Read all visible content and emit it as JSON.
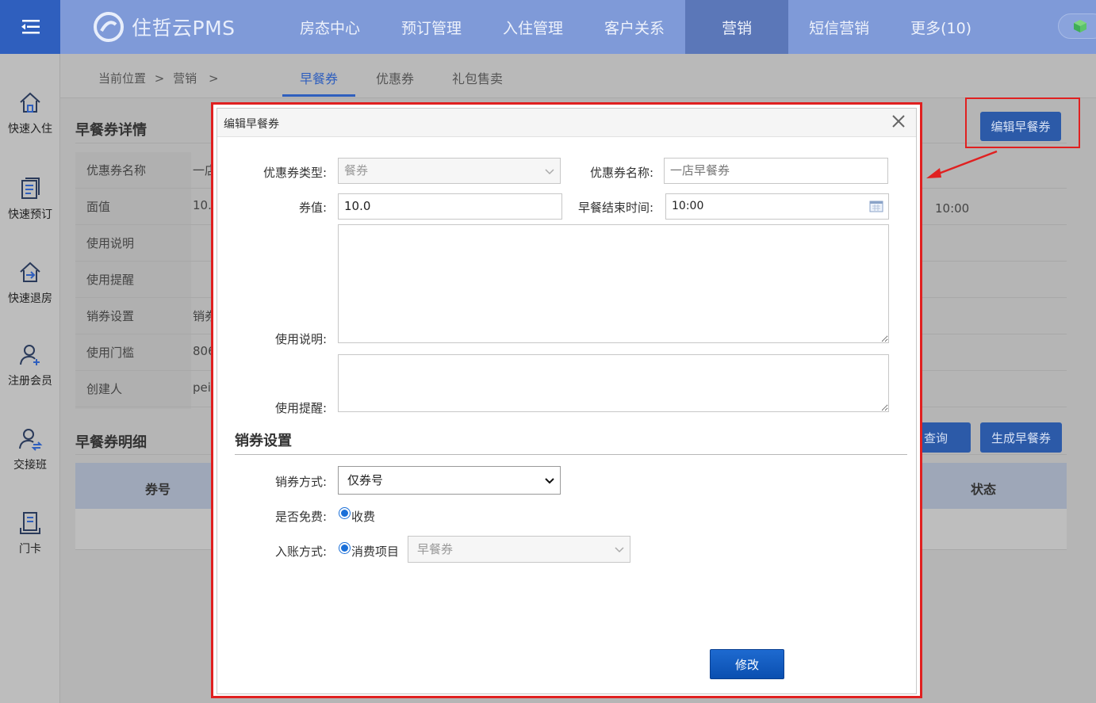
{
  "app": {
    "title": "住哲云PMS",
    "nav": [
      "房态中心",
      "预订管理",
      "入住管理",
      "客户关系",
      "营销",
      "短信营销",
      "更多(10)"
    ],
    "active_nav": "营销"
  },
  "sidebar": {
    "items": [
      {
        "label": "快速入住",
        "icon": "home-icon"
      },
      {
        "label": "快速预订",
        "icon": "list-icon"
      },
      {
        "label": "快速退房",
        "icon": "checkout-icon"
      },
      {
        "label": "注册会员",
        "icon": "add-user-icon"
      },
      {
        "label": "交接班",
        "icon": "shift-icon"
      },
      {
        "label": "门卡",
        "icon": "card-icon"
      }
    ]
  },
  "breadcrumb": {
    "position": "当前位置",
    "sep": ">",
    "section": "营销",
    "trail": ">"
  },
  "subtabs": [
    "早餐券",
    "优惠券",
    "礼包售卖"
  ],
  "detail": {
    "title": "早餐券详情",
    "edit_button": "编辑早餐券",
    "rows": [
      {
        "label": "优惠券名称",
        "value": "一店"
      },
      {
        "label": "面值",
        "value": "10."
      },
      {
        "label": "使用说明",
        "value": ""
      },
      {
        "label": "使用提醒",
        "value": ""
      },
      {
        "label": "销券设置",
        "value": "销券"
      },
      {
        "label": "使用门槛",
        "value": "806"
      },
      {
        "label": "创建人",
        "value": "pei"
      }
    ],
    "right_value": "10:00"
  },
  "list": {
    "title": "早餐券明细",
    "query_button": "查询",
    "generate_button": "生成早餐券",
    "columns": [
      "券号",
      "状态"
    ]
  },
  "modal": {
    "title": "编辑早餐券",
    "fields": {
      "type_label": "优惠券类型:",
      "type_value": "餐券",
      "name_label": "优惠券名称:",
      "name_value": "一店早餐券",
      "amount_label": "券值:",
      "amount_value": "10.0",
      "end_time_label": "早餐结束时间:",
      "end_time_value": "10:00",
      "desc_label": "使用说明:",
      "remind_label": "使用提醒:"
    },
    "sales_section": "销券设置",
    "sales_mode_label": "销券方式:",
    "sales_mode_value": "仅券号",
    "free_label": "是否免费:",
    "free_option": "收费",
    "account_label": "入账方式:",
    "account_option": "消费项目",
    "account_item": "早餐券",
    "submit": "修改"
  },
  "colors": {
    "accent": "#2f5fbe",
    "highlight": "#e02020",
    "button": "#0a4fb0"
  }
}
